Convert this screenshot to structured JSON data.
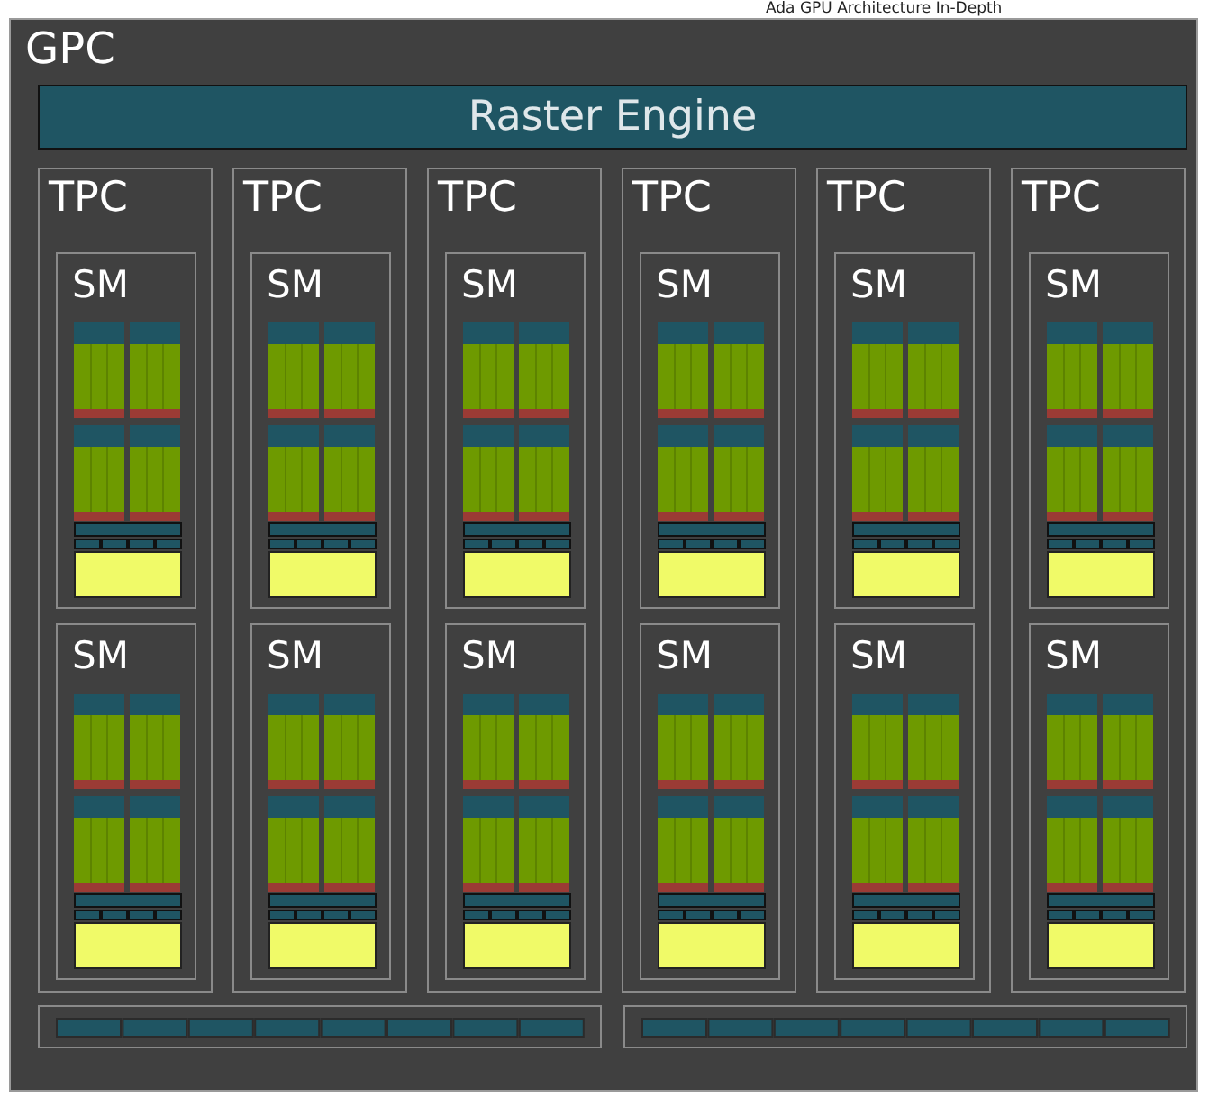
{
  "page_header": "Ada GPU Architecture In-Depth",
  "gpc": {
    "label": "GPC",
    "raster_engine": "Raster Engine",
    "tpcs": [
      {
        "label": "TPC",
        "sms": [
          {
            "label": "SM"
          },
          {
            "label": "SM"
          }
        ]
      },
      {
        "label": "TPC",
        "sms": [
          {
            "label": "SM"
          },
          {
            "label": "SM"
          }
        ]
      },
      {
        "label": "TPC",
        "sms": [
          {
            "label": "SM"
          },
          {
            "label": "SM"
          }
        ]
      },
      {
        "label": "TPC",
        "sms": [
          {
            "label": "SM"
          },
          {
            "label": "SM"
          }
        ]
      },
      {
        "label": "TPC",
        "sms": [
          {
            "label": "SM"
          },
          {
            "label": "SM"
          }
        ]
      },
      {
        "label": "TPC",
        "sms": [
          {
            "label": "SM"
          },
          {
            "label": "SM"
          }
        ]
      }
    ]
  }
}
